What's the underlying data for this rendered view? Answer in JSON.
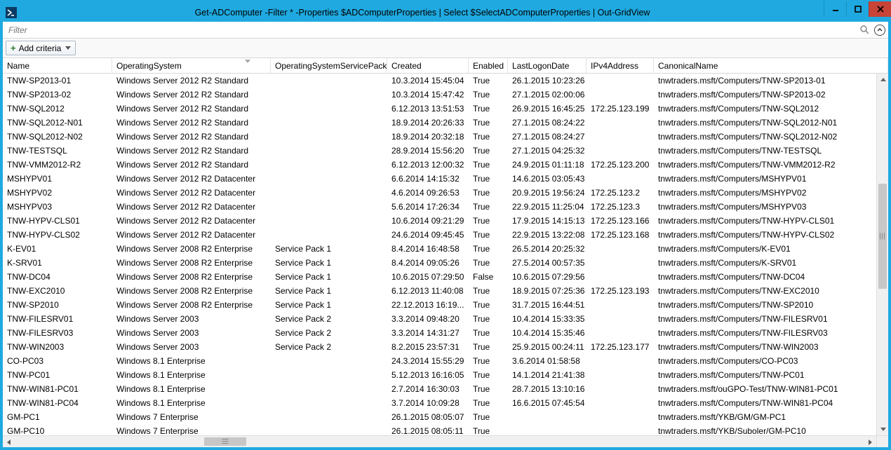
{
  "window": {
    "title": "Get-ADComputer -Filter * -Properties $ADComputerProperties | Select $SelectADComputerProperties | Out-GridView"
  },
  "filter": {
    "placeholder": "Filter"
  },
  "criteria": {
    "add_label": "Add criteria"
  },
  "columns": {
    "name": "Name",
    "os": "OperatingSystem",
    "sp": "OperatingSystemServicePack",
    "created": "Created",
    "enabled": "Enabled",
    "logon": "LastLogonDate",
    "ip": "IPv4Address",
    "canon": "CanonicalName"
  },
  "rows": [
    {
      "name": "TNW-SP2013-01",
      "os": "Windows Server 2012 R2 Standard",
      "sp": "",
      "created": "10.3.2014 15:45:04",
      "enabled": "True",
      "logon": "26.1.2015 10:23:26",
      "ip": "",
      "canon": "tnwtraders.msft/Computers/TNW-SP2013-01"
    },
    {
      "name": "TNW-SP2013-02",
      "os": "Windows Server 2012 R2 Standard",
      "sp": "",
      "created": "10.3.2014 15:47:42",
      "enabled": "True",
      "logon": "27.1.2015 02:00:06",
      "ip": "",
      "canon": "tnwtraders.msft/Computers/TNW-SP2013-02"
    },
    {
      "name": "TNW-SQL2012",
      "os": "Windows Server 2012 R2 Standard",
      "sp": "",
      "created": "6.12.2013 13:51:53",
      "enabled": "True",
      "logon": "26.9.2015 16:45:25",
      "ip": "172.25.123.199",
      "canon": "tnwtraders.msft/Computers/TNW-SQL2012"
    },
    {
      "name": "TNW-SQL2012-N01",
      "os": "Windows Server 2012 R2 Standard",
      "sp": "",
      "created": "18.9.2014 20:26:33",
      "enabled": "True",
      "logon": "27.1.2015 08:24:22",
      "ip": "",
      "canon": "tnwtraders.msft/Computers/TNW-SQL2012-N01"
    },
    {
      "name": "TNW-SQL2012-N02",
      "os": "Windows Server 2012 R2 Standard",
      "sp": "",
      "created": "18.9.2014 20:32:18",
      "enabled": "True",
      "logon": "27.1.2015 08:24:27",
      "ip": "",
      "canon": "tnwtraders.msft/Computers/TNW-SQL2012-N02"
    },
    {
      "name": "TNW-TESTSQL",
      "os": "Windows Server 2012 R2 Standard",
      "sp": "",
      "created": "28.9.2014 15:56:20",
      "enabled": "True",
      "logon": "27.1.2015 04:25:32",
      "ip": "",
      "canon": "tnwtraders.msft/Computers/TNW-TESTSQL"
    },
    {
      "name": "TNW-VMM2012-R2",
      "os": "Windows Server 2012 R2 Standard",
      "sp": "",
      "created": "6.12.2013 12:00:32",
      "enabled": "True",
      "logon": "24.9.2015 01:11:18",
      "ip": "172.25.123.200",
      "canon": "tnwtraders.msft/Computers/TNW-VMM2012-R2"
    },
    {
      "name": "MSHYPV01",
      "os": "Windows Server 2012 R2 Datacenter",
      "sp": "",
      "created": "6.6.2014 14:15:32",
      "enabled": "True",
      "logon": "14.6.2015 03:05:43",
      "ip": "",
      "canon": "tnwtraders.msft/Computers/MSHYPV01"
    },
    {
      "name": "MSHYPV02",
      "os": "Windows Server 2012 R2 Datacenter",
      "sp": "",
      "created": "4.6.2014 09:26:53",
      "enabled": "True",
      "logon": "20.9.2015 19:56:24",
      "ip": "172.25.123.2",
      "canon": "tnwtraders.msft/Computers/MSHYPV02"
    },
    {
      "name": "MSHYPV03",
      "os": "Windows Server 2012 R2 Datacenter",
      "sp": "",
      "created": "5.6.2014 17:26:34",
      "enabled": "True",
      "logon": "22.9.2015 11:25:04",
      "ip": "172.25.123.3",
      "canon": "tnwtraders.msft/Computers/MSHYPV03"
    },
    {
      "name": "TNW-HYPV-CLS01",
      "os": "Windows Server 2012 R2 Datacenter",
      "sp": "",
      "created": "10.6.2014 09:21:29",
      "enabled": "True",
      "logon": "17.9.2015 14:15:13",
      "ip": "172.25.123.166",
      "canon": "tnwtraders.msft/Computers/TNW-HYPV-CLS01"
    },
    {
      "name": "TNW-HYPV-CLS02",
      "os": "Windows Server 2012 R2 Datacenter",
      "sp": "",
      "created": "24.6.2014 09:45:45",
      "enabled": "True",
      "logon": "22.9.2015 13:22:08",
      "ip": "172.25.123.168",
      "canon": "tnwtraders.msft/Computers/TNW-HYPV-CLS02"
    },
    {
      "name": "K-EV01",
      "os": "Windows Server 2008 R2 Enterprise",
      "sp": "Service Pack 1",
      "created": "8.4.2014 16:48:58",
      "enabled": "True",
      "logon": "26.5.2014 20:25:32",
      "ip": "",
      "canon": "tnwtraders.msft/Computers/K-EV01"
    },
    {
      "name": "K-SRV01",
      "os": "Windows Server 2008 R2 Enterprise",
      "sp": "Service Pack 1",
      "created": "8.4.2014 09:05:26",
      "enabled": "True",
      "logon": "27.5.2014 00:57:35",
      "ip": "",
      "canon": "tnwtraders.msft/Computers/K-SRV01"
    },
    {
      "name": "TNW-DC04",
      "os": "Windows Server 2008 R2 Enterprise",
      "sp": "Service Pack 1",
      "created": "10.6.2015 07:29:50",
      "enabled": "False",
      "logon": "10.6.2015 07:29:56",
      "ip": "",
      "canon": "tnwtraders.msft/Computers/TNW-DC04"
    },
    {
      "name": "TNW-EXC2010",
      "os": "Windows Server 2008 R2 Enterprise",
      "sp": "Service Pack 1",
      "created": "6.12.2013 11:40:08",
      "enabled": "True",
      "logon": "18.9.2015 07:25:36",
      "ip": "172.25.123.193",
      "canon": "tnwtraders.msft/Computers/TNW-EXC2010"
    },
    {
      "name": "TNW-SP2010",
      "os": "Windows Server 2008 R2 Enterprise",
      "sp": "Service Pack 1",
      "created": "22.12.2013 16:19...",
      "enabled": "True",
      "logon": "31.7.2015 16:44:51",
      "ip": "",
      "canon": "tnwtraders.msft/Computers/TNW-SP2010"
    },
    {
      "name": "TNW-FILESRV01",
      "os": "Windows Server 2003",
      "sp": "Service Pack 2",
      "created": "3.3.2014 09:48:20",
      "enabled": "True",
      "logon": "10.4.2014 15:33:35",
      "ip": "",
      "canon": "tnwtraders.msft/Computers/TNW-FILESRV01"
    },
    {
      "name": "TNW-FILESRV03",
      "os": "Windows Server 2003",
      "sp": "Service Pack 2",
      "created": "3.3.2014 14:31:27",
      "enabled": "True",
      "logon": "10.4.2014 15:35:46",
      "ip": "",
      "canon": "tnwtraders.msft/Computers/TNW-FILESRV03"
    },
    {
      "name": "TNW-WIN2003",
      "os": "Windows Server 2003",
      "sp": "Service Pack 2",
      "created": "8.2.2015 23:57:31",
      "enabled": "True",
      "logon": "25.9.2015 00:24:11",
      "ip": "172.25.123.177",
      "canon": "tnwtraders.msft/Computers/TNW-WIN2003"
    },
    {
      "name": "CO-PC03",
      "os": "Windows 8.1 Enterprise",
      "sp": "",
      "created": "24.3.2014 15:55:29",
      "enabled": "True",
      "logon": "3.6.2014 01:58:58",
      "ip": "",
      "canon": "tnwtraders.msft/Computers/CO-PC03"
    },
    {
      "name": "TNW-PC01",
      "os": "Windows 8.1 Enterprise",
      "sp": "",
      "created": "5.12.2013 16:16:05",
      "enabled": "True",
      "logon": "14.1.2014 21:41:38",
      "ip": "",
      "canon": "tnwtraders.msft/Computers/TNW-PC01"
    },
    {
      "name": "TNW-WIN81-PC01",
      "os": "Windows 8.1 Enterprise",
      "sp": "",
      "created": "2.7.2014 16:30:03",
      "enabled": "True",
      "logon": "28.7.2015 13:10:16",
      "ip": "",
      "canon": "tnwtraders.msft/ouGPO-Test/TNW-WIN81-PC01"
    },
    {
      "name": "TNW-WIN81-PC04",
      "os": "Windows 8.1 Enterprise",
      "sp": "",
      "created": "3.7.2014 10:09:28",
      "enabled": "True",
      "logon": "16.6.2015 07:45:54",
      "ip": "",
      "canon": "tnwtraders.msft/Computers/TNW-WIN81-PC04"
    },
    {
      "name": "GM-PC1",
      "os": "Windows 7 Enterprise",
      "sp": "",
      "created": "26.1.2015 08:05:07",
      "enabled": "True",
      "logon": "",
      "ip": "",
      "canon": "tnwtraders.msft/YKB/GM/GM-PC1"
    },
    {
      "name": "GM-PC10",
      "os": "Windows 7 Enterprise",
      "sp": "",
      "created": "26.1.2015 08:05:11",
      "enabled": "True",
      "logon": "",
      "ip": "",
      "canon": "tnwtraders.msft/YKB/Suboler/GM-PC10"
    }
  ]
}
